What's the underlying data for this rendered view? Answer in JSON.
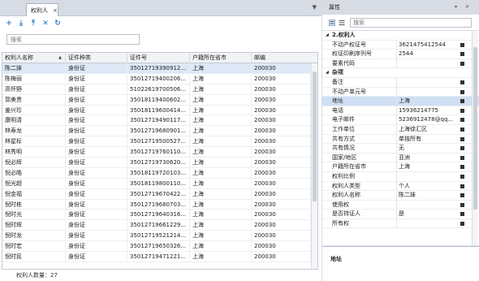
{
  "tab": {
    "label": "权利人",
    "close": "×",
    "scroll": "▼"
  },
  "toolbar": {
    "buttons": [
      {
        "icon": "add-icon",
        "glyph": "+",
        "color": "#2a7bd1"
      },
      {
        "icon": "import-icon",
        "glyph": "⤓",
        "color": "#2a7bd1"
      },
      {
        "icon": "export-icon",
        "glyph": "⤒",
        "color": "#2a7bd1"
      },
      {
        "icon": "delete-icon",
        "glyph": "✕",
        "color": "#2a7bd1"
      },
      {
        "icon": "refresh-icon",
        "glyph": "↻",
        "color": "#2a7bd1"
      }
    ]
  },
  "search": {
    "placeholder": "搜索"
  },
  "grid": {
    "columns": [
      "权利人名称",
      "证件种类",
      "证件号",
      "户籍所在省市",
      "邮编"
    ],
    "sort_indicator": "▲",
    "rows": [
      [
        "陈二妹",
        "身份证",
        "35012719390912...",
        "上海",
        "200030"
      ],
      [
        "陈梅丽",
        "身份证",
        "35012719400206...",
        "上海",
        "200030"
      ],
      [
        "高怀野",
        "身份证",
        "51022619700506...",
        "上海",
        "200030"
      ],
      [
        "郭美贵",
        "身份证",
        "35018119400602...",
        "上海",
        "200030"
      ],
      [
        "姜兴珍",
        "身份证",
        "35018119600414...",
        "上海",
        "200030"
      ],
      [
        "康明清",
        "身份证",
        "35012719490117...",
        "上海",
        "200030"
      ],
      [
        "林寿龙",
        "身份证",
        "35012719680901...",
        "上海",
        "200030"
      ],
      [
        "林星标",
        "身份证",
        "35012719500527...",
        "上海",
        "200030"
      ],
      [
        "林秀明",
        "身份证",
        "35012719760110...",
        "上海",
        "200030"
      ],
      [
        "倪必辉",
        "身份证",
        "35012719730620...",
        "上海",
        "200030"
      ],
      [
        "倪必皓",
        "身份证",
        "35018119720103...",
        "上海",
        "200030"
      ],
      [
        "倪光超",
        "身份证",
        "35018119800110...",
        "上海",
        "200030"
      ],
      [
        "倪金福",
        "身份证",
        "35012719670422...",
        "上海",
        "200030"
      ],
      [
        "倪时栋",
        "身份证",
        "35012719680703...",
        "上海",
        "200030"
      ],
      [
        "倪时光",
        "身份证",
        "35012719640316...",
        "上海",
        "200030"
      ],
      [
        "倪时辉",
        "身份证",
        "35012719661229...",
        "上海",
        "200030"
      ],
      [
        "倪时龙",
        "身份证",
        "35012719521214...",
        "上海",
        "200030"
      ],
      [
        "倪时宏",
        "身份证",
        "35012719650326...",
        "上海",
        "200030"
      ],
      [
        "倪时民",
        "身份证",
        "35012719471221...",
        "上海",
        "200030"
      ]
    ]
  },
  "status": {
    "label": "权利人数量：27"
  },
  "properties": {
    "title": "属性",
    "pin": "▾ ✕",
    "search_placeholder": "搜索",
    "rows": [
      {
        "type": "group",
        "name": "2.权利人",
        "toggle": "◢"
      },
      {
        "name": "不动产权证号",
        "value": "3621475412544",
        "box": true
      },
      {
        "name": "权证印刷序列号",
        "value": "2544",
        "box": true
      },
      {
        "name": "要素代码",
        "value": "",
        "box": true
      },
      {
        "type": "group",
        "name": "杂项",
        "toggle": "◢"
      },
      {
        "name": "备注",
        "value": "",
        "box": true
      },
      {
        "name": "不动产单元号",
        "value": "",
        "box": true
      },
      {
        "name": "地址",
        "value": "上海",
        "box": true,
        "sel": true
      },
      {
        "name": "电话",
        "value": "15936214775",
        "box": true
      },
      {
        "name": "电子邮件",
        "value": "5236912478@qq...",
        "box": true
      },
      {
        "name": "工作单位",
        "value": "上海徐汇区",
        "box": true
      },
      {
        "name": "共有方式",
        "value": "单独所有",
        "box": true
      },
      {
        "name": "共有情况",
        "value": "无",
        "box": true
      },
      {
        "name": "国家/地区",
        "value": "亚洲",
        "box": true
      },
      {
        "name": "户籍所在省市",
        "value": "上海",
        "box": true
      },
      {
        "name": "权利比例",
        "value": "",
        "box": true
      },
      {
        "name": "权利人类型",
        "value": "个人",
        "box": true
      },
      {
        "name": "权利人名称",
        "value": "陈二妹",
        "box": true
      },
      {
        "name": "使用权",
        "value": "",
        "box": true
      },
      {
        "name": "是否持证人",
        "value": "是",
        "box": true
      },
      {
        "name": "所有权",
        "value": "",
        "box": true
      }
    ],
    "description_title": "地址"
  }
}
